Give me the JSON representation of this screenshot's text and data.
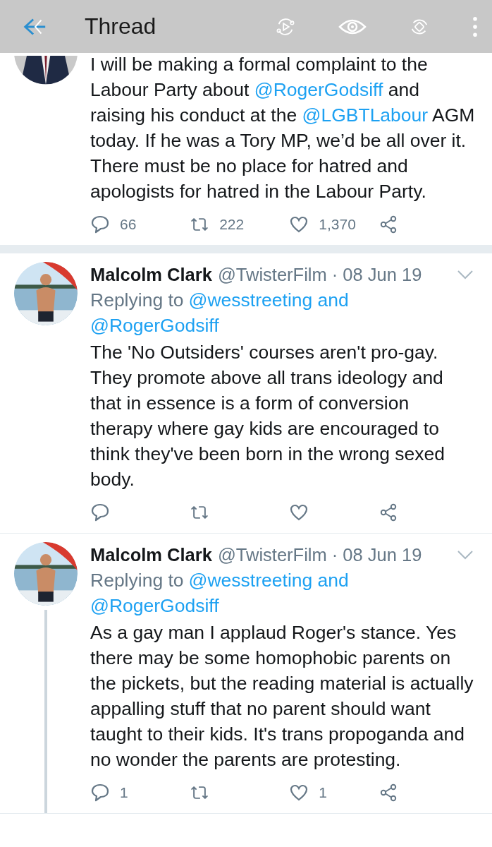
{
  "header": {
    "title": "Thread"
  },
  "tweets": [
    {
      "kind": "focused",
      "segments": [
        {
          "kind": "text",
          "text": "I will be making a formal complaint to the Labour Party about "
        },
        {
          "kind": "mention",
          "text": "@RogerGodsiff"
        },
        {
          "kind": "text",
          "text": " and raising his conduct at the "
        },
        {
          "kind": "mention",
          "text": "@LGBTLabour"
        },
        {
          "kind": "text",
          "text": " AGM today. If he was a Tory MP, we’d be all over it. There must be no place for hatred and apologists for hatred in the Labour Party."
        }
      ],
      "actions": [
        {
          "kind": "reply",
          "count": "66"
        },
        {
          "kind": "retweet",
          "count": "222"
        },
        {
          "kind": "like",
          "count": "1,370"
        },
        {
          "kind": "share"
        }
      ]
    },
    {
      "kind": "reply",
      "name": "Malcolm Clark",
      "handle": "@TwisterFilm · 08 Jun 19",
      "thread_line": false,
      "reply_label": "Replying to",
      "reply_mentions": [
        "@wesstreeting and",
        "@RogerGodsiff"
      ],
      "segments": [
        {
          "kind": "text",
          "text": "The 'No Outsiders' courses aren't pro-gay. They promote above all trans ideology and that in essence is a form of conversion therapy where gay kids are encouraged to think they've been born in the wrong sexed body."
        }
      ],
      "actions": [
        {
          "kind": "reply"
        },
        {
          "kind": "retweet"
        },
        {
          "kind": "like"
        },
        {
          "kind": "share"
        }
      ]
    },
    {
      "kind": "reply",
      "name": "Malcolm Clark",
      "handle": "@TwisterFilm · 08 Jun 19",
      "thread_line": true,
      "reply_label": "Replying to",
      "reply_mentions": [
        "@wesstreeting and",
        "@RogerGodsiff"
      ],
      "segments": [
        {
          "kind": "text",
          "text": "As a gay man I applaud Roger's stance. Yes there may be some homophobic parents on the pickets, but the reading material is actually appalling stuff that no parent should want taught to their kids. It's trans propoganda and no wonder the parents are protesting."
        }
      ],
      "actions": [
        {
          "kind": "reply",
          "count": "1"
        },
        {
          "kind": "retweet"
        },
        {
          "kind": "like",
          "count": "1"
        },
        {
          "kind": "share"
        }
      ]
    }
  ]
}
